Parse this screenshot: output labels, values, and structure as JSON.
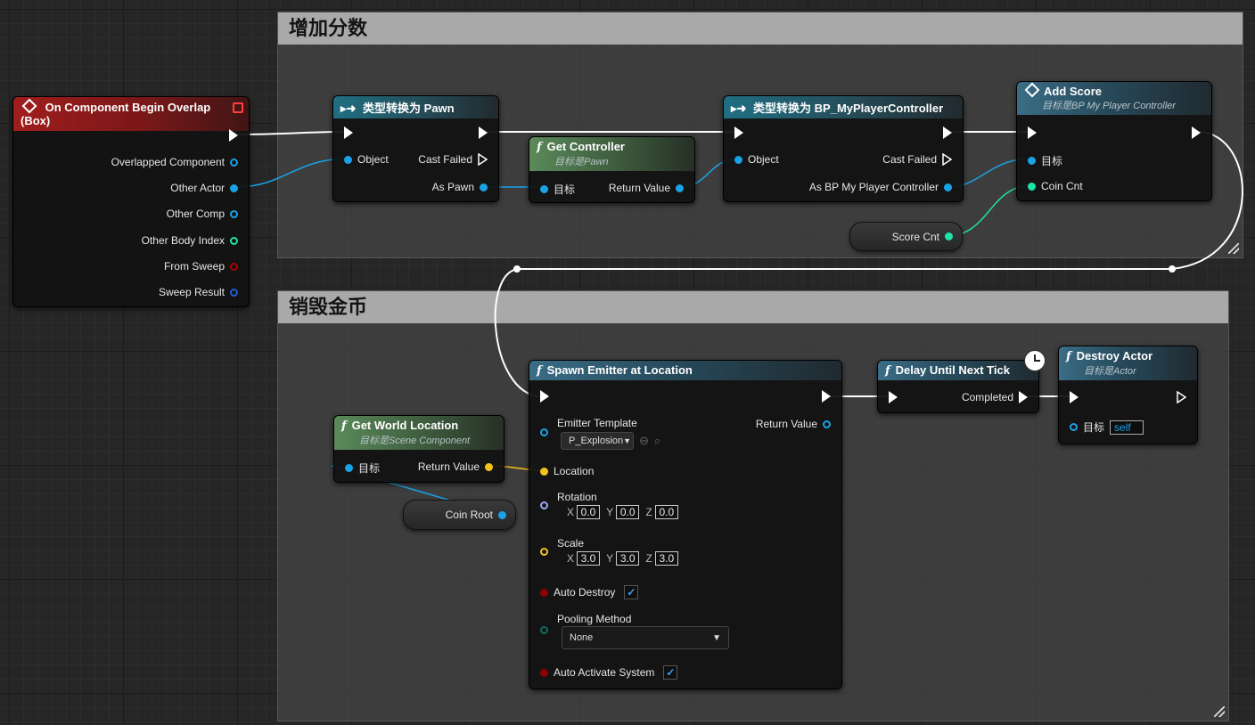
{
  "colors": {
    "exec": "#ffffff",
    "object": "#19a3e6",
    "int": "#1ee3a7",
    "vector": "#f5c21b",
    "rotator": "#9aa8f5",
    "bool": "#8c0000",
    "struct": "#1d5fd6",
    "enum": "#0e6b62",
    "event_header": "#a11d1d",
    "function_header": "#3a6d86",
    "pure_function_header": "#5b8a5a"
  },
  "comments": {
    "top": {
      "title": "增加分数"
    },
    "bottom": {
      "title": "销毁金币"
    }
  },
  "event_node": {
    "title": "On Component Begin Overlap (Box)",
    "pins": [
      {
        "label": "Overlapped Component",
        "type": "object"
      },
      {
        "label": "Other Actor",
        "type": "object"
      },
      {
        "label": "Other Comp",
        "type": "object"
      },
      {
        "label": "Other Body Index",
        "type": "int"
      },
      {
        "label": "From Sweep",
        "type": "bool"
      },
      {
        "label": "Sweep Result",
        "type": "struct"
      }
    ]
  },
  "cast_pawn": {
    "title": "类型转换为 Pawn",
    "object_label": "Object",
    "cast_failed_label": "Cast Failed",
    "output_label": "As Pawn"
  },
  "get_controller": {
    "title": "Get Controller",
    "subtitle": "目标是Pawn",
    "target_label": "目标",
    "return_label": "Return Value"
  },
  "cast_controller": {
    "title": "类型转换为 BP_MyPlayerController",
    "object_label": "Object",
    "cast_failed_label": "Cast Failed",
    "output_label": "As BP My Player Controller"
  },
  "add_score": {
    "title": "Add Score",
    "subtitle": "目标是BP My Player Controller",
    "target_label": "目标",
    "coin_label": "Coin Cnt"
  },
  "score_cnt": {
    "label": "Score Cnt"
  },
  "get_world_location": {
    "title": "Get World Location",
    "subtitle": "目标是Scene Component",
    "target_label": "目标",
    "return_label": "Return Value"
  },
  "coin_root": {
    "label": "Coin Root"
  },
  "spawn_emitter": {
    "title": "Spawn Emitter at Location",
    "emitter_template_label": "Emitter Template",
    "emitter_template_value": "P_Explosion",
    "return_label": "Return Value",
    "location_label": "Location",
    "rotation_label": "Rotation",
    "rotation": {
      "x": "0.0",
      "y": "0.0",
      "z": "0.0"
    },
    "scale_label": "Scale",
    "scale": {
      "x": "3.0",
      "y": "3.0",
      "z": "3.0"
    },
    "auto_destroy_label": "Auto Destroy",
    "auto_destroy": true,
    "pooling_label": "Pooling Method",
    "pooling_value": "None",
    "auto_activate_label": "Auto Activate System",
    "auto_activate": true,
    "axis_x": "X",
    "axis_y": "Y",
    "axis_z": "Z"
  },
  "delay_node": {
    "title": "Delay Until Next Tick",
    "completed_label": "Completed"
  },
  "destroy_actor": {
    "title": "Destroy Actor",
    "subtitle": "目标是Actor",
    "target_label": "目标",
    "target_value": "self"
  }
}
